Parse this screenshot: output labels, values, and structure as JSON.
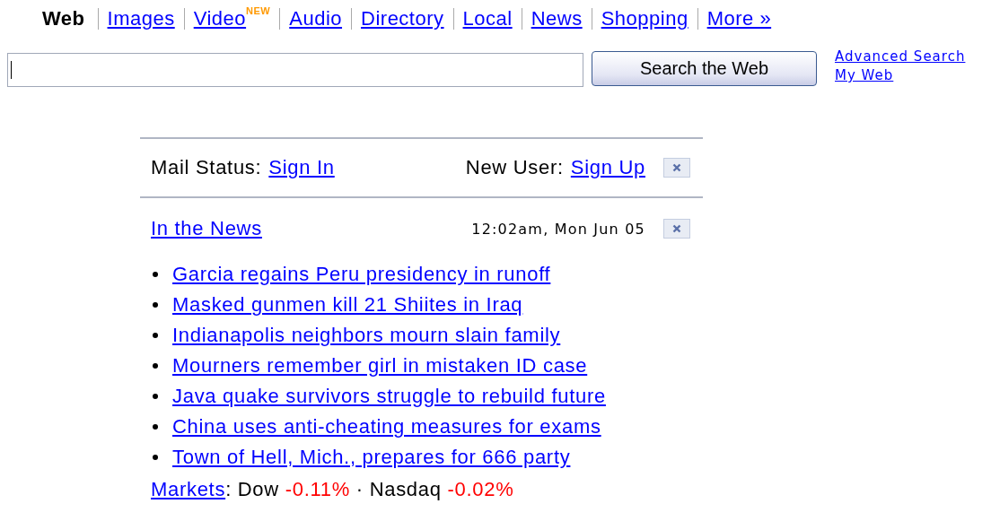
{
  "tabs": [
    {
      "label": "Web",
      "selected": true
    },
    {
      "label": "Images",
      "selected": false
    },
    {
      "label": "Video",
      "selected": false,
      "badge": "NEW"
    },
    {
      "label": "Audio",
      "selected": false
    },
    {
      "label": "Directory",
      "selected": false
    },
    {
      "label": "Local",
      "selected": false
    },
    {
      "label": "News",
      "selected": false
    },
    {
      "label": "Shopping",
      "selected": false
    },
    {
      "label": "More »",
      "selected": false
    }
  ],
  "search": {
    "button": "Search the Web",
    "links": [
      "Advanced Search",
      "My Web"
    ]
  },
  "mail": {
    "label": "Mail Status:",
    "link": "Sign In",
    "new_user_label": "New User:",
    "new_user_link": "Sign Up"
  },
  "news": {
    "title": "In the News",
    "time": "12:02am, Mon Jun 05",
    "items": [
      "Garcia regains Peru presidency in runoff",
      "Masked gunmen kill 21 Shiites in Iraq",
      "Indianapolis neighbors mourn slain family",
      "Mourners remember girl in mistaken ID case",
      "Java quake survivors struggle to rebuild future",
      "China uses anti-cheating measures for exams",
      "Town of Hell, Mich., prepares for 666 party"
    ]
  },
  "markets": {
    "link": "Markets",
    "colon": ":",
    "separator": "·",
    "indices": [
      {
        "name": "Dow",
        "change": "-0.11%",
        "down": true
      },
      {
        "name": "Nasdaq",
        "change": "-0.02%",
        "down": true
      }
    ]
  }
}
